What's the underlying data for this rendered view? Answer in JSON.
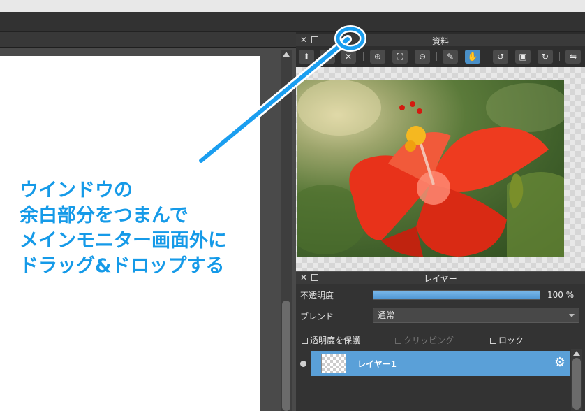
{
  "reference_panel": {
    "title": "資料",
    "toolbar": [
      {
        "name": "import-icon",
        "glyph": "⬆"
      },
      {
        "name": "open-file-icon",
        "glyph": "▭"
      },
      {
        "name": "clear-icon",
        "glyph": "✕"
      },
      {
        "name": "zoom-in-icon",
        "glyph": "⊕"
      },
      {
        "name": "fit-screen-icon",
        "glyph": "⛶"
      },
      {
        "name": "zoom-out-icon",
        "glyph": "⊖"
      },
      {
        "name": "eyedropper-icon",
        "glyph": "✎"
      },
      {
        "name": "hand-icon",
        "glyph": "✋",
        "active": true
      },
      {
        "name": "rotate-left-icon",
        "glyph": "↺"
      },
      {
        "name": "reset-rotation-icon",
        "glyph": "▣"
      },
      {
        "name": "rotate-right-icon",
        "glyph": "↻"
      },
      {
        "name": "flip-icon",
        "glyph": "⇋"
      }
    ]
  },
  "layer_panel": {
    "title": "レイヤー",
    "opacity_label": "不透明度",
    "opacity_value": "100 %",
    "opacity_fraction": 1.0,
    "blend_label": "ブレンド",
    "blend_value": "通常",
    "checkboxes": {
      "protect_transparency": "透明度を保護",
      "clipping": "クリッピング",
      "lock": "ロック"
    },
    "layer_name": "レイヤー1"
  },
  "annotation": {
    "line1": "ウインドウの",
    "line2": "余白部分をつまんで",
    "line3": "メインモニター画面外に",
    "line4": "ドラッグ&ドロップする"
  },
  "colors": {
    "accent": "#4a90c8",
    "annotation": "#159ae8"
  }
}
